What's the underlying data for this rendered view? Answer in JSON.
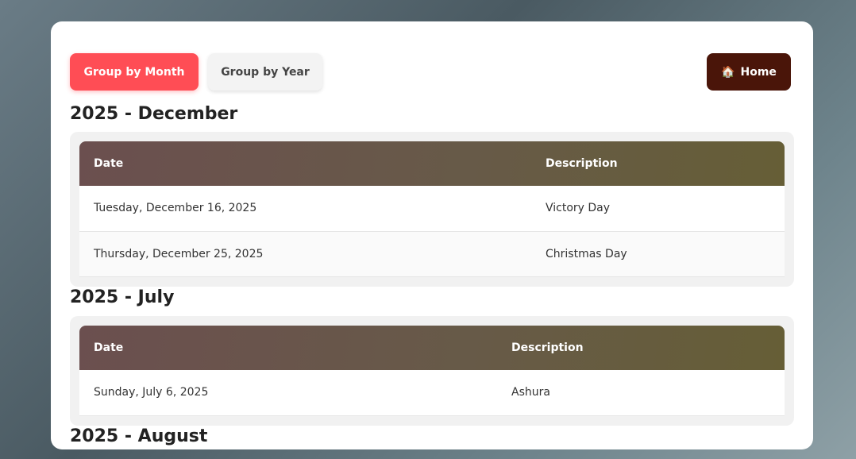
{
  "toolbar": {
    "group_by_month": "Group by Month",
    "group_by_year": "Group by Year",
    "home_icon": "🏠",
    "home_label": "Home"
  },
  "colors": {
    "accent": "#ff4d55",
    "home_button": "#4a1509"
  },
  "groups": [
    {
      "title": "2025 - December",
      "headers": [
        "Date",
        "Description"
      ],
      "rows": [
        {
          "date": "Tuesday, December 16, 2025",
          "description": "Victory Day"
        },
        {
          "date": "Thursday, December 25, 2025",
          "description": "Christmas Day"
        }
      ]
    },
    {
      "title": "2025 - July",
      "headers": [
        "Date",
        "Description"
      ],
      "rows": [
        {
          "date": "Sunday, July 6, 2025",
          "description": "Ashura"
        }
      ]
    },
    {
      "title": "2025 - August",
      "headers": [],
      "rows": []
    }
  ]
}
